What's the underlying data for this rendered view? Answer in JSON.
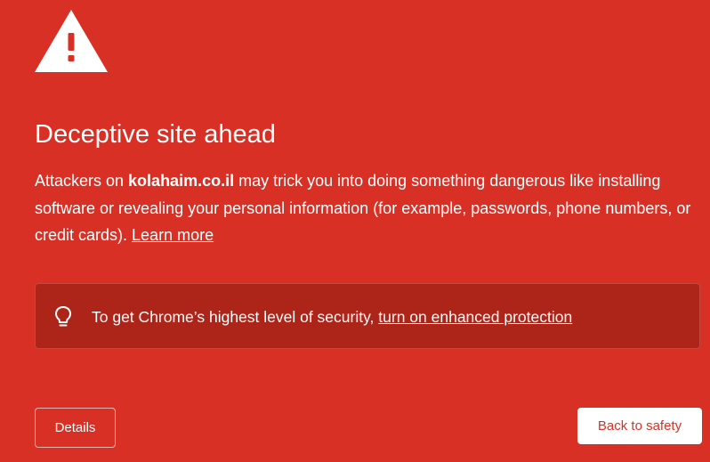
{
  "interstitial": {
    "icon": "warning-triangle-icon",
    "title": "Deceptive site ahead",
    "body": {
      "prefix": "Attackers on ",
      "domain": "kolahaim.co.il",
      "suffix": " may trick you into doing something dangerous like installing software or revealing your personal information (for example, passwords, phone numbers, or credit cards). ",
      "learn_more": "Learn more"
    }
  },
  "promo": {
    "icon": "lightbulb-icon",
    "text": "To get Chrome’s highest level of security, ",
    "link": "turn on enhanced protection"
  },
  "buttons": {
    "details": "Details",
    "back_to_safety": "Back to safety"
  },
  "colors": {
    "background": "#d93025",
    "promo_background": "#ad2419",
    "text": "#ffffff",
    "primary_button_text": "#d93025"
  }
}
